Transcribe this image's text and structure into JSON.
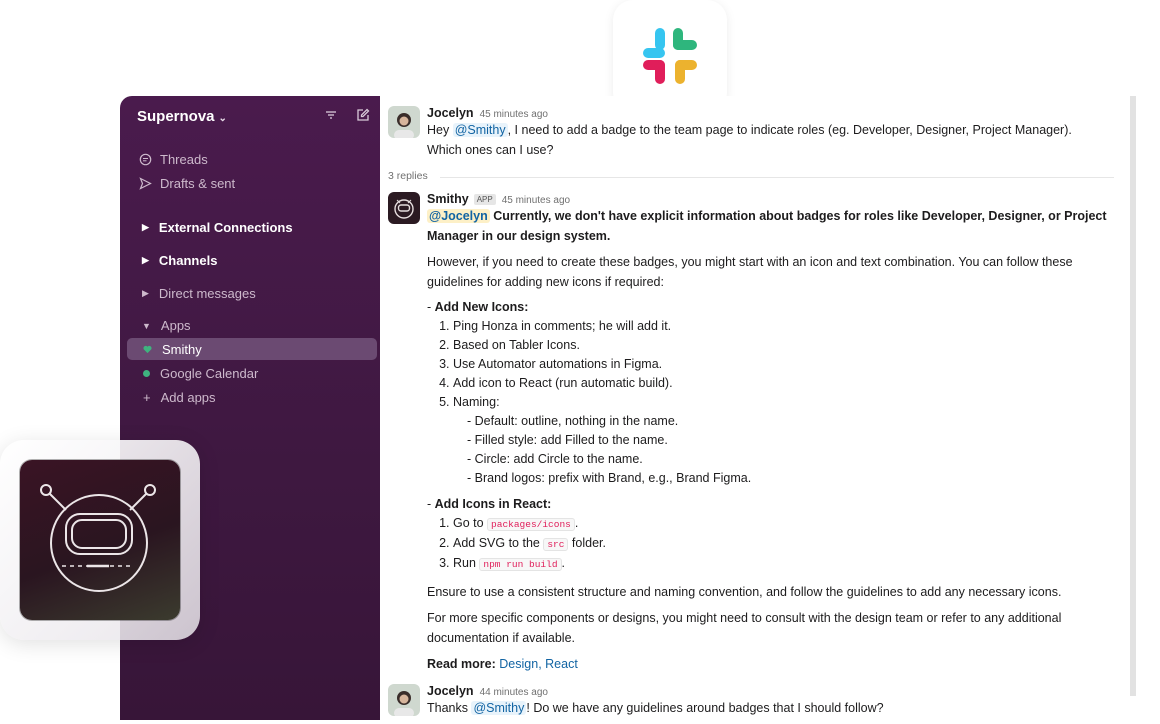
{
  "workspace": {
    "name": "Supernova"
  },
  "sidebar": {
    "nav": [
      {
        "label": "Threads",
        "icon": "threads-icon"
      },
      {
        "label": "Drafts & sent",
        "icon": "send-icon"
      }
    ],
    "sections": [
      {
        "label": "External Connections",
        "expanded": false
      },
      {
        "label": "Channels",
        "expanded": false
      },
      {
        "label": "Direct messages",
        "expanded": false
      },
      {
        "label": "Apps",
        "expanded": true
      }
    ],
    "apps": [
      {
        "label": "Smithy",
        "active": true
      },
      {
        "label": "Google Calendar",
        "active": false
      },
      {
        "label": "Add apps",
        "active": false
      }
    ]
  },
  "thread": {
    "msg1": {
      "author": "Jocelyn",
      "time": "45 minutes ago",
      "pre": "Hey ",
      "mention": "@Smithy",
      "post": ", I need to add a badge to the team page to indicate roles (eg. Developer, Designer, Project Manager). Which ones can I use?"
    },
    "replies": "3 replies",
    "msg2": {
      "author": "Smithy",
      "tag": "APP",
      "time": "45 minutes ago",
      "mention": "@Jocelyn",
      "bold": " Currently, we don't have explicit information about badges for roles like Developer, Designer, or Project Manager in our design system.",
      "para1": "However, if you need to create these badges, you might start with an icon and text combination. You can follow these guidelines for adding new icons if required:",
      "section1": "Add New Icons:",
      "steps1": [
        "Ping Honza in comments; he will add it.",
        "Based on Tabler Icons.",
        "Use Automator automations in Figma.",
        "Add icon to React (run automatic build).",
        "Naming:"
      ],
      "naming": [
        "- Default: outline, nothing in the name.",
        "- Filled style: add Filled to the name.",
        "- Circle: add Circle to the name.",
        "- Brand logos: prefix with Brand, e.g., Brand Figma."
      ],
      "section2": "Add Icons in React:",
      "steps2": {
        "s1_pre": "Go to ",
        "s1_code": "packages/icons",
        "s1_post": ".",
        "s2_pre": "Add SVG to the ",
        "s2_code": "src",
        "s2_post": " folder.",
        "s3_pre": "Run ",
        "s3_code": "npm run build",
        "s3_post": "."
      },
      "para2": "Ensure to use a consistent structure and naming convention, and follow the guidelines to add any necessary icons.",
      "para3": "For more specific components or designs, you might need to consult with the design team or refer to any additional documentation if available.",
      "readmore_label": "Read more:",
      "link1": "Design",
      "link_sep": ", ",
      "link2": "React"
    },
    "msg3": {
      "author": "Jocelyn",
      "time": "44 minutes ago",
      "pre": "Thanks ",
      "mention": "@Smithy",
      "post": "! Do we have any guidelines around badges that I should follow?"
    }
  },
  "colors": {
    "sidebar": "#3f0e40",
    "accent_link": "#1264a3",
    "code": "#e01e5a",
    "online": "#3fb37f"
  }
}
